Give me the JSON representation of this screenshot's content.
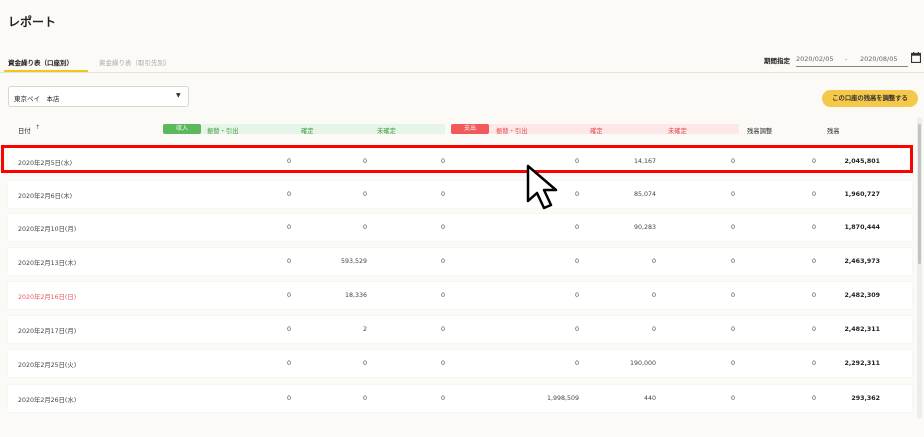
{
  "page": {
    "title": "レポート"
  },
  "tabs": [
    {
      "label": "資金繰り表（口座別）",
      "active": true
    },
    {
      "label": "資金繰り表（取引先別）",
      "active": false
    }
  ],
  "period": {
    "label": "期間指定",
    "from": "2020/02/05",
    "separator": "-",
    "to": "2020/08/05",
    "icon": "calendar-icon"
  },
  "account_select": {
    "value": "東京ペイ　本店",
    "icon": "caret-down-icon"
  },
  "adjust_button": {
    "label": "この口座の残高を調整する",
    "color": "#f5c84a"
  },
  "table": {
    "headers": {
      "date": "日付",
      "sort_icon": "↑",
      "income_badge": "収入",
      "income_transfer": "振替・引出",
      "income_confirmed": "確定",
      "income_unconfirmed": "未確定",
      "expense_badge": "支出",
      "expense_transfer": "振替・引出",
      "expense_confirmed": "確定",
      "expense_unconfirmed": "未確定",
      "adjust": "残高調整",
      "balance": "残高"
    },
    "colors": {
      "income": "#5cb85c",
      "expense": "#f05a5a",
      "holiday": "#e85a5a",
      "highlight": "#ff0000"
    },
    "rows": [
      {
        "date": "2020年2月5日(水)",
        "holiday": false,
        "in_transfer": "0",
        "in_confirmed": "0",
        "in_unconfirmed": "0",
        "out_transfer": "0",
        "out_confirmed": "14,167",
        "out_unconfirmed": "0",
        "adjust": "0",
        "balance": "2,045,801",
        "highlighted": true
      },
      {
        "date": "2020年2月6日(木)",
        "holiday": false,
        "in_transfer": "0",
        "in_confirmed": "0",
        "in_unconfirmed": "0",
        "out_transfer": "0",
        "out_confirmed": "85,074",
        "out_unconfirmed": "0",
        "adjust": "0",
        "balance": "1,960,727"
      },
      {
        "date": "2020年2月10日(月)",
        "holiday": false,
        "in_transfer": "0",
        "in_confirmed": "0",
        "in_unconfirmed": "0",
        "out_transfer": "0",
        "out_confirmed": "90,283",
        "out_unconfirmed": "0",
        "adjust": "0",
        "balance": "1,870,444"
      },
      {
        "date": "2020年2月13日(木)",
        "holiday": false,
        "in_transfer": "0",
        "in_confirmed": "593,529",
        "in_unconfirmed": "0",
        "out_transfer": "0",
        "out_confirmed": "0",
        "out_unconfirmed": "0",
        "adjust": "0",
        "balance": "2,463,973"
      },
      {
        "date": "2020年2月16日(日)",
        "holiday": true,
        "in_transfer": "0",
        "in_confirmed": "18,336",
        "in_unconfirmed": "0",
        "out_transfer": "0",
        "out_confirmed": "0",
        "out_unconfirmed": "0",
        "adjust": "0",
        "balance": "2,482,309"
      },
      {
        "date": "2020年2月17日(月)",
        "holiday": false,
        "in_transfer": "0",
        "in_confirmed": "2",
        "in_unconfirmed": "0",
        "out_transfer": "0",
        "out_confirmed": "0",
        "out_unconfirmed": "0",
        "adjust": "0",
        "balance": "2,482,311"
      },
      {
        "date": "2020年2月25日(火)",
        "holiday": false,
        "in_transfer": "0",
        "in_confirmed": "0",
        "in_unconfirmed": "0",
        "out_transfer": "0",
        "out_confirmed": "190,000",
        "out_unconfirmed": "0",
        "adjust": "0",
        "balance": "2,292,311"
      },
      {
        "date": "2020年2月26日(水)",
        "holiday": false,
        "in_transfer": "0",
        "in_confirmed": "0",
        "in_unconfirmed": "0",
        "out_transfer": "1,998,509",
        "out_confirmed": "440",
        "out_unconfirmed": "0",
        "adjust": "0",
        "balance": "293,362"
      }
    ]
  },
  "cursor": {
    "icon": "mouse-pointer-icon"
  }
}
